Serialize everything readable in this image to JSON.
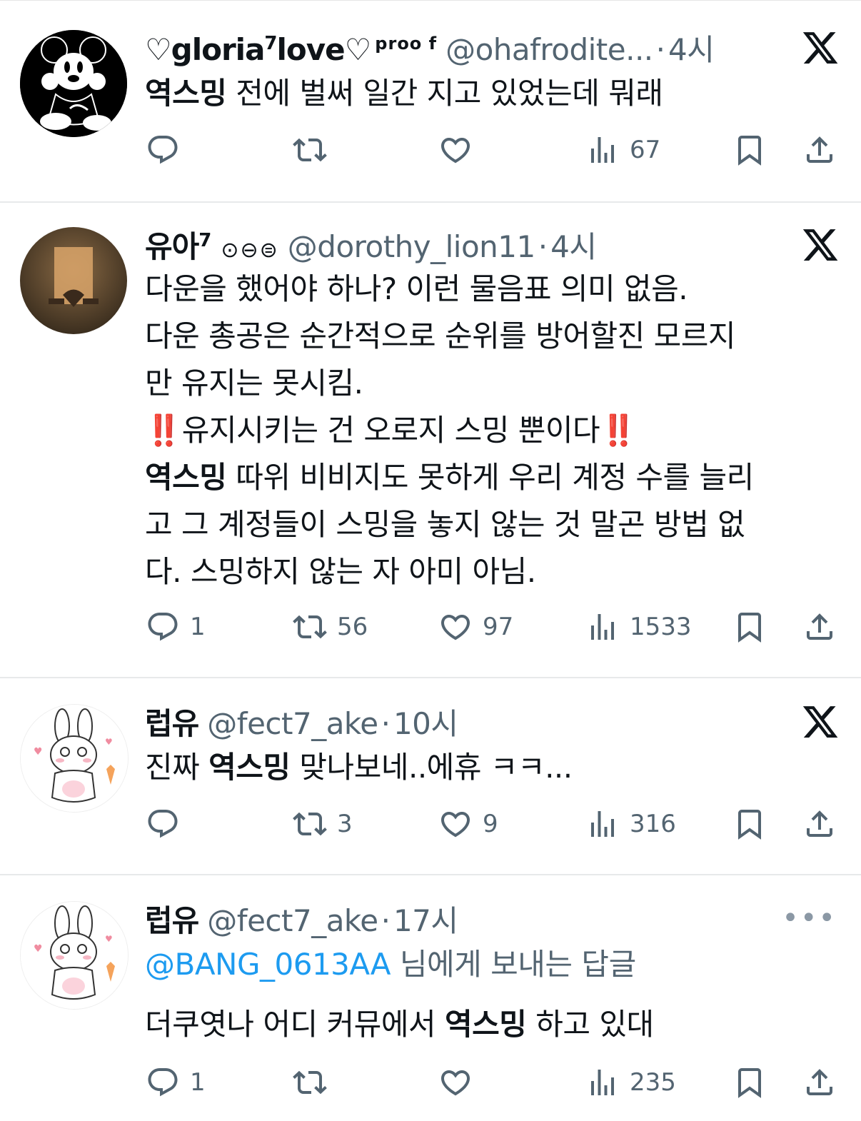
{
  "colors": {
    "text": "#0f1419",
    "muted": "#536471",
    "link": "#1d9bf0",
    "separator": "#e7e9ea"
  },
  "tweets": [
    {
      "display_name": "♡gloria",
      "name_sup": "7",
      "name_rest": "love♡",
      "name_suffix": "proo f",
      "handle": "@ohafrodite...",
      "dot": "·",
      "time": "4시",
      "text_bold": "역스밍",
      "text": " 전에 벌써 일간 지고 있었는데 뭐래",
      "stats": {
        "reply": "",
        "retweet": "",
        "like": "",
        "views": "67"
      },
      "avatar_icon": "mickey-avatar-icon"
    },
    {
      "display_name": "유아",
      "name_sup": "7",
      "badges": "⊙⊖⊜",
      "handle": "@dorothy_lion11",
      "dot": "·",
      "time": "4시",
      "lines": [
        "다운을 했어야 하나? 이런 물음표 의미 없음.",
        "다운 총공은 순간적으로 순위를 방어할진 모르지",
        "만 유지는 못시킴.",
        "‼️유지시키는 건 오로지 스밍 뿐이다‼️"
      ],
      "text_bold": "역스밍",
      "text_tail_1": " 따위 비비지도 못하게 우리 계정 수를 늘리",
      "text_tail_2": "고 그 계정들이 스밍을 놓지 않는 것 말곤 방법 없",
      "text_tail_3": "다.  스밍하지 않는 자 아미 아님.",
      "stats": {
        "reply": "1",
        "retweet": "56",
        "like": "97",
        "views": "1533"
      }
    },
    {
      "display_name": "럽유",
      "handle": "@fect7_ake",
      "dot": "·",
      "time": "10시",
      "text_pre": "진짜 ",
      "text_bold": "역스밍",
      "text": " 맞나보네..에휴 ㅋㅋ...",
      "stats": {
        "reply": "",
        "retweet": "3",
        "like": "9",
        "views": "316"
      }
    },
    {
      "display_name": "럽유",
      "handle": "@fect7_ake",
      "dot": "·",
      "time": "17시",
      "reply_to": "@BANG_0613AA",
      "reply_suffix": " 님에게 보내는 답글",
      "text_pre": "더쿠엿나 어디 커뮤에서 ",
      "text_bold": "역스밍",
      "text": " 하고 있대",
      "stats": {
        "reply": "1",
        "retweet": "",
        "like": "",
        "views": "235"
      }
    }
  ]
}
